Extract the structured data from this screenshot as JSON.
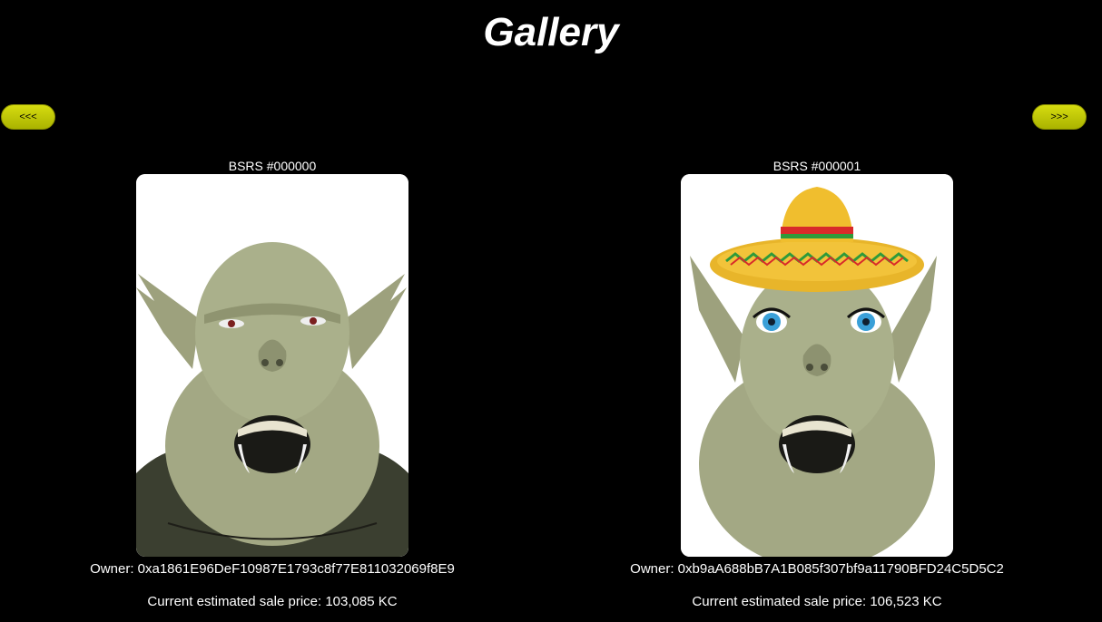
{
  "header": {
    "title": "Gallery"
  },
  "navigation": {
    "prev_label": "<<<",
    "next_label": ">>>"
  },
  "colors": {
    "background": "#000000",
    "button": "#c6cc00",
    "text": "#ffffff"
  },
  "gallery": {
    "items": [
      {
        "name": "BSRS #000000",
        "owner": "Owner: 0xa1861E96DeF10987E1793c8f77E811032069f8E9",
        "price": "Current estimated sale price: 103,085 KC",
        "image_icon": "ogre-portrait-shirt"
      },
      {
        "name": "BSRS #000001",
        "owner": "Owner: 0xb9aA688bB7A1B085f307bf9a11790BFD24C5D5C2",
        "price": "Current estimated sale price: 106,523 KC",
        "image_icon": "ogre-portrait-sombrero"
      }
    ]
  }
}
